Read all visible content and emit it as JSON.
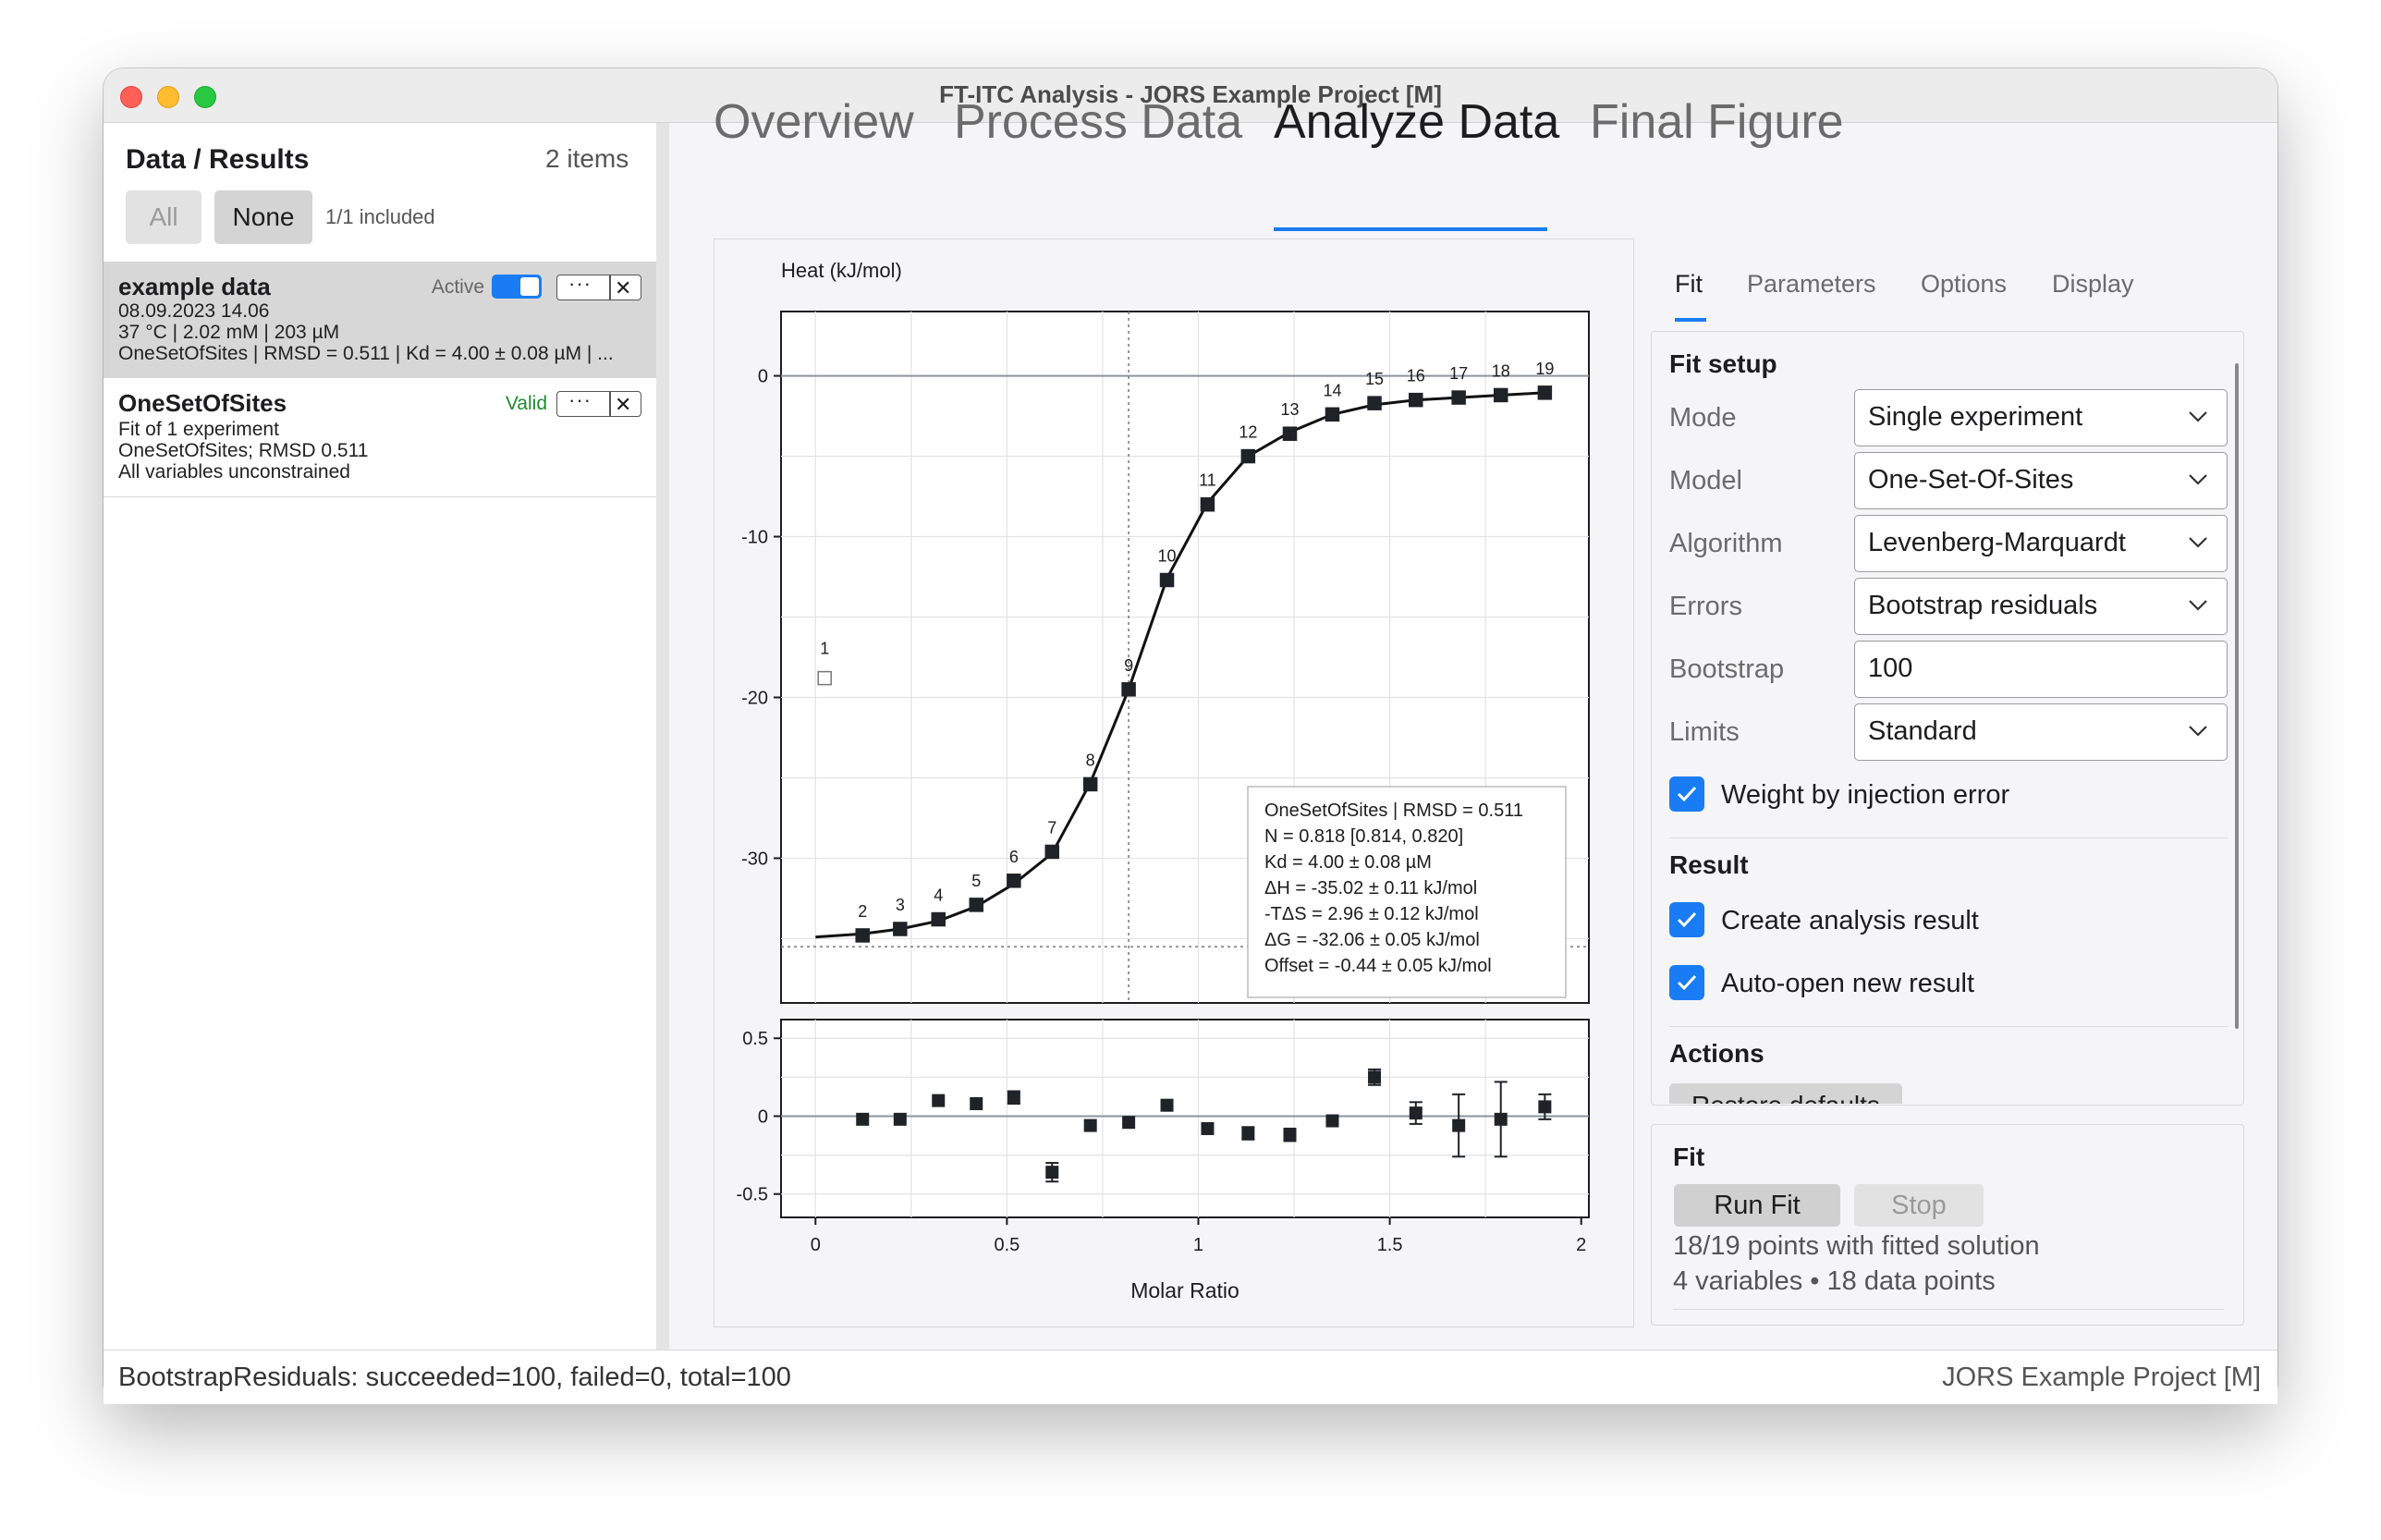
{
  "window": {
    "title": "FT-ITC Analysis - JORS Example Project [M]"
  },
  "sidebar": {
    "title": "Data / Results",
    "count": "2 items",
    "all_label": "All",
    "none_label": "None",
    "included": "1/1 included",
    "items": [
      {
        "name": "example data",
        "status": "Active",
        "lines": [
          "08.09.2023 14.06",
          "37 °C | 2.02 mM | 203 µM",
          "OneSetOfSites | RMSD = 0.511 | Kd = 4.00 ± 0.08 µM | ..."
        ]
      },
      {
        "name": "OneSetOfSites",
        "status": "Valid",
        "lines": [
          "Fit of 1 experiment",
          "OneSetOfSites; RMSD 0.511",
          "All variables unconstrained"
        ]
      }
    ],
    "more_glyph": "···",
    "close_glyph": "✕"
  },
  "tabs": [
    "Overview",
    "Process Data",
    "Analyze Data",
    "Final Figure"
  ],
  "right_tabs": [
    "Fit",
    "Parameters",
    "Options",
    "Display"
  ],
  "fit_setup": {
    "title": "Fit setup",
    "rows": [
      {
        "label": "Mode",
        "value": "Single experiment"
      },
      {
        "label": "Model",
        "value": "One-Set-Of-Sites"
      },
      {
        "label": "Algorithm",
        "value": "Levenberg-Marquardt"
      },
      {
        "label": "Errors",
        "value": "Bootstrap residuals"
      },
      {
        "label": "Bootstrap",
        "value": "100"
      },
      {
        "label": "Limits",
        "value": "Standard"
      }
    ],
    "weight_label": "Weight by injection error"
  },
  "result": {
    "title": "Result",
    "create_label": "Create analysis result",
    "autoopen_label": "Auto-open new result"
  },
  "actions": {
    "title": "Actions",
    "restore_label": "Restore defaults"
  },
  "fit": {
    "title": "Fit",
    "run_label": "Run Fit",
    "stop_label": "Stop",
    "line1": "18/19 points with fitted solution",
    "line2": "4 variables • 18 data points"
  },
  "status": {
    "left": "BootstrapResiduals: succeeded=100, failed=0, total=100",
    "right": "JORS Example Project [M]"
  },
  "colors": {
    "accent": "#1a7cf5",
    "point": "#1f2328",
    "valid": "#1f8a2f"
  },
  "chart_data": [
    {
      "type": "scatter",
      "title": "",
      "ylabel": "Heat (kJ/mol)",
      "xlabel": "",
      "xlim": [
        -0.09,
        2.02
      ],
      "ylim": [
        -39,
        4
      ],
      "yticks": [
        0,
        -10,
        -20,
        -30
      ],
      "grid": true,
      "x": [
        0.024,
        0.123,
        0.221,
        0.321,
        0.42,
        0.518,
        0.618,
        0.718,
        0.818,
        0.918,
        1.024,
        1.13,
        1.239,
        1.35,
        1.46,
        1.568,
        1.68,
        1.79,
        1.905
      ],
      "y": [
        -18.8,
        -34.8,
        -34.4,
        -33.8,
        -32.9,
        -31.4,
        -29.6,
        -25.4,
        -19.5,
        -12.7,
        -8.0,
        -5.0,
        -3.6,
        -2.4,
        -1.7,
        -1.5,
        -1.35,
        -1.2,
        -1.05
      ],
      "labels": [
        "1",
        "2",
        "3",
        "4",
        "5",
        "6",
        "7",
        "8",
        "9",
        "10",
        "11",
        "12",
        "13",
        "14",
        "15",
        "16",
        "17",
        "18",
        "19"
      ],
      "excluded": [
        0
      ],
      "fit_line": {
        "x": [
          0.0,
          0.123,
          0.221,
          0.321,
          0.42,
          0.518,
          0.618,
          0.718,
          0.818,
          0.918,
          1.024,
          1.13,
          1.239,
          1.35,
          1.46,
          1.568,
          1.68,
          1.79,
          1.905
        ],
        "y": [
          -34.9,
          -34.7,
          -34.4,
          -33.9,
          -33.0,
          -31.6,
          -29.7,
          -25.3,
          -19.5,
          -12.6,
          -7.9,
          -5.0,
          -3.5,
          -2.4,
          -1.8,
          -1.5,
          -1.35,
          -1.2,
          -1.05
        ]
      },
      "reference_x": 0.818,
      "reference_y": -35.5,
      "annotation": {
        "lines": [
          "OneSetOfSites | RMSD = 0.511",
          "N = 0.818 [0.814, 0.820]",
          "Kd = 4.00 ± 0.08 µM",
          "ΔH = -35.02 ± 0.11 kJ/mol",
          "-TΔS = 2.96 ± 0.12 kJ/mol",
          "ΔG = -32.06 ± 0.05 kJ/mol",
          "Offset = -0.44 ± 0.05 kJ/mol"
        ]
      }
    },
    {
      "type": "scatter",
      "title": "",
      "xlabel": "Molar Ratio",
      "ylabel": "",
      "xlim": [
        -0.09,
        2.02
      ],
      "ylim": [
        -0.65,
        0.62
      ],
      "xticks": [
        0,
        0.5,
        1,
        1.5,
        2
      ],
      "xtick_labels": [
        "0",
        "0.5",
        "1",
        "1.5",
        "2"
      ],
      "yticks": [
        0.5,
        0,
        -0.5
      ],
      "ytick_labels": [
        "0.5",
        "0",
        "-0.5"
      ],
      "grid": true,
      "x": [
        0.123,
        0.221,
        0.321,
        0.42,
        0.518,
        0.618,
        0.718,
        0.818,
        0.918,
        1.024,
        1.13,
        1.239,
        1.35,
        1.46,
        1.568,
        1.68,
        1.79,
        1.905
      ],
      "y": [
        -0.02,
        -0.02,
        0.1,
        0.08,
        0.12,
        -0.36,
        -0.06,
        -0.04,
        0.07,
        -0.08,
        -0.11,
        -0.12,
        -0.03,
        0.25,
        0.02,
        -0.06,
        -0.02,
        0.06
      ],
      "err": [
        0,
        0,
        0,
        0,
        0.04,
        0.06,
        0,
        0,
        0,
        0,
        0.04,
        0.04,
        0,
        0.05,
        0.07,
        0.2,
        0.24,
        0.08
      ]
    }
  ]
}
